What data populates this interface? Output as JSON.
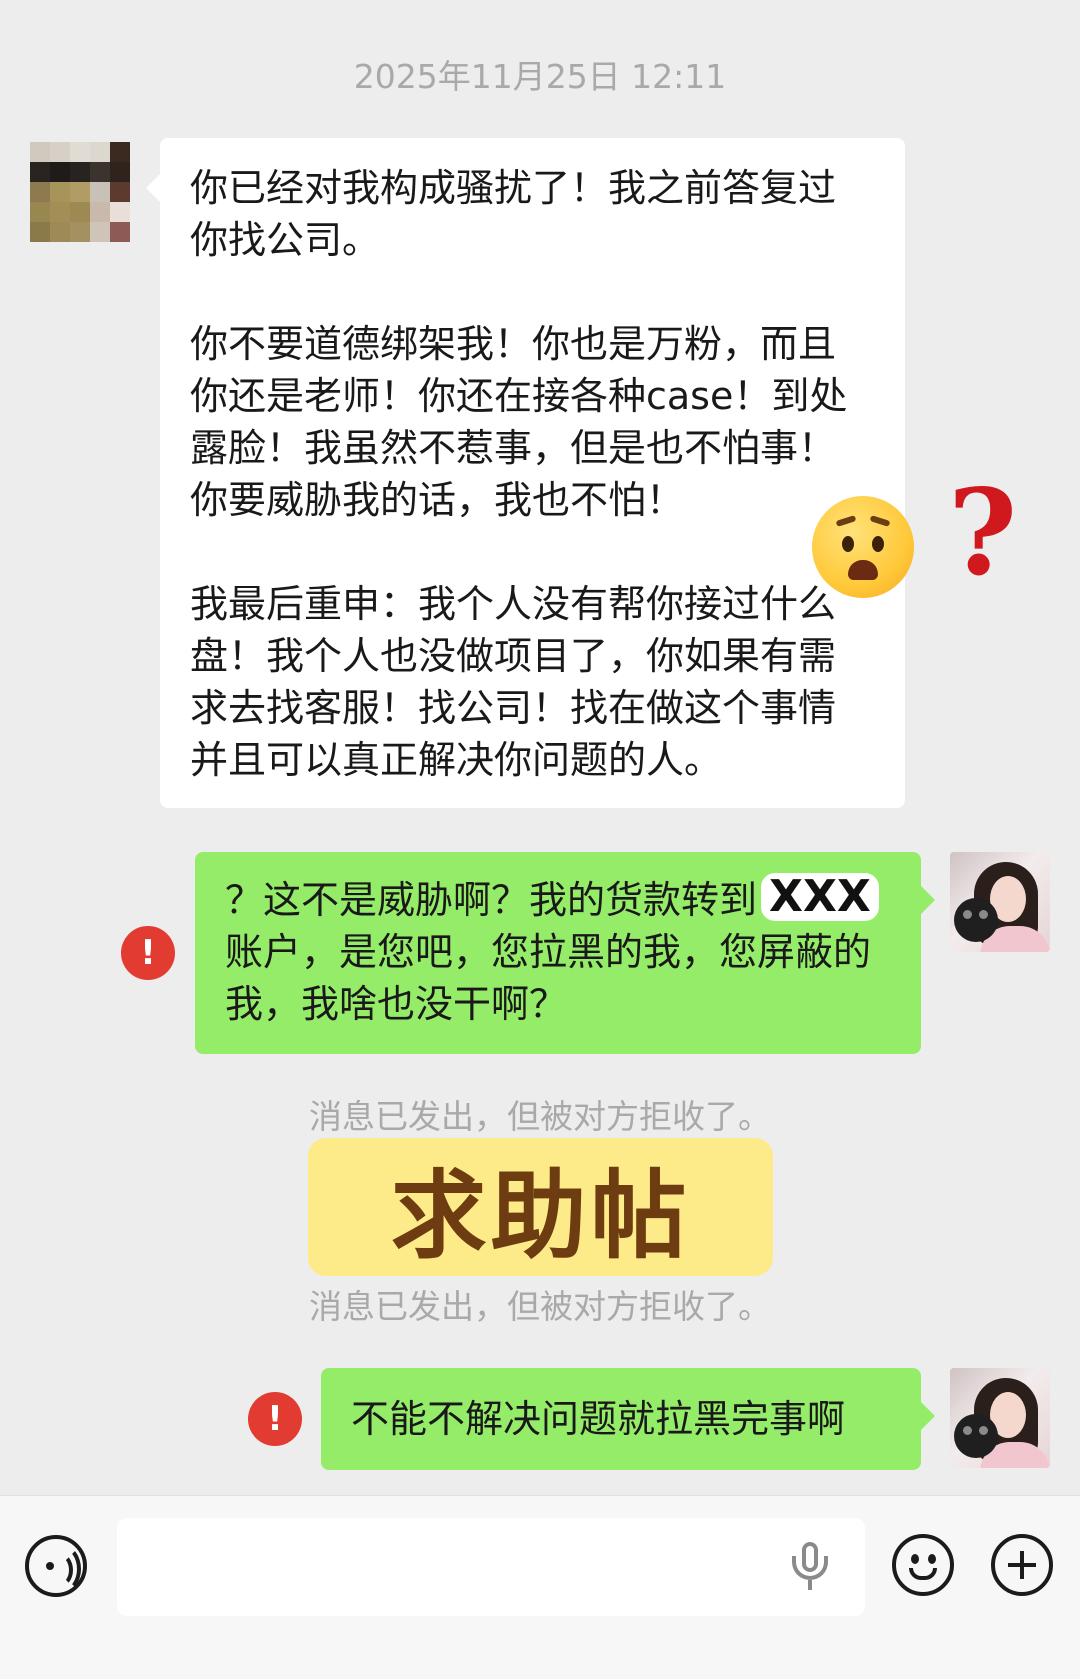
{
  "timestamp": "2025年11月25日 12:11",
  "messages": {
    "incoming": {
      "paragraphs": [
        "你已经对我构成骚扰了！我之前答复过你找公司。",
        "你不要道德绑架我！你也是万粉，而且你还是老师！你还在接各种case！到处露脸！我虽然不惹事，但是也不怕事！你要威胁我的话，我也不怕！",
        "我最后重申：我个人没有帮你接过什么盘！我个人也没做项目了，你如果有需求去找客服！找公司！找在做这个事情并且可以真正解决你问题的人。"
      ]
    },
    "outgoing1": {
      "text_before": "？这不是威胁啊？我的货款转到",
      "redacted": "XXX",
      "text_after": "账户，是您吧，您拉黑的我，您屏蔽的我，我啥也没干啊？",
      "error_mark": "!"
    },
    "rejected_notice_1": "消息已发出，但被对方拒收了。",
    "overlay_banner": "求助帖",
    "rejected_notice_2": "消息已发出，但被对方拒收了。",
    "outgoing2": {
      "text": "不能不解决问题就拉黑完事啊",
      "error_mark": "!"
    },
    "annotation_mark": "?"
  },
  "input_bar": {
    "placeholder": "",
    "icons": [
      "voice-icon",
      "microphone-icon",
      "emoji-icon",
      "plus-icon"
    ]
  },
  "colors": {
    "background": "#ededed",
    "incoming_bubble": "#ffffff",
    "outgoing_bubble": "#95ec69",
    "error_red": "#e23b32",
    "banner_yellow": "#fdeb8a",
    "banner_text": "#6e3c11"
  }
}
